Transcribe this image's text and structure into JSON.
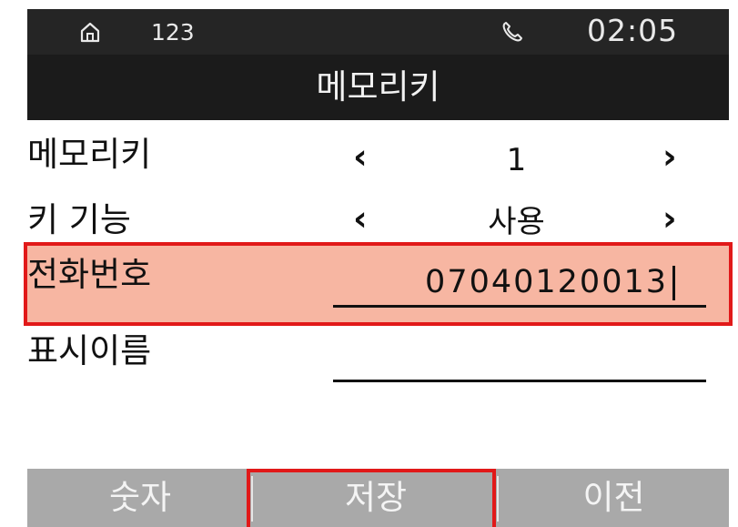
{
  "status_bar": {
    "extension": "123",
    "time": "02:05",
    "icons": [
      "home-icon",
      "phone-icon"
    ]
  },
  "title": "메모리키",
  "rows": {
    "memory_key": {
      "label": "메모리키",
      "value": "1",
      "prev": "‹",
      "next": "›"
    },
    "key_function": {
      "label": "키 기능",
      "value": "사용",
      "prev": "‹",
      "next": "›"
    },
    "phone_number": {
      "label": "전화번호",
      "value": "07040120013"
    },
    "display_name": {
      "label": "표시이름",
      "value": ""
    }
  },
  "softkeys": {
    "left": "숫자",
    "center": "저장",
    "right": "이전"
  },
  "colors": {
    "highlight_fill": "#f7b6a2",
    "highlight_border": "#e11919",
    "titlebar": "#1b1b1b",
    "softkey_bar": "#a9a9a9"
  }
}
